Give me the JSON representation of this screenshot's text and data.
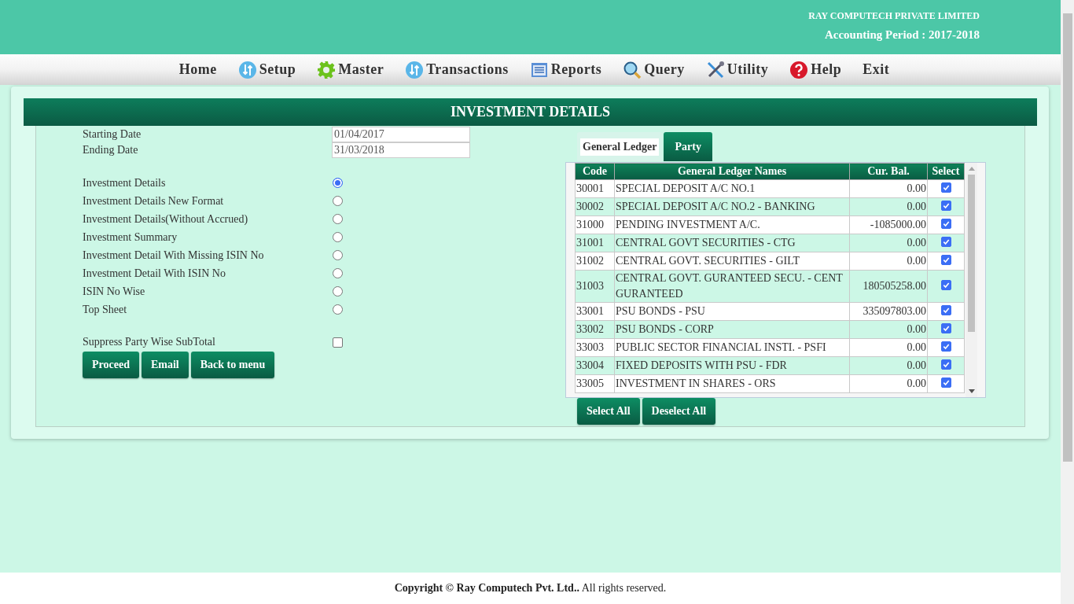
{
  "header": {
    "company": "RAY COMPUTECH PRIVATE LIMITED",
    "period": "Accounting Period : 2017-2018"
  },
  "nav": [
    {
      "label": "Home",
      "kind": "plain"
    },
    {
      "label": "Setup",
      "kind": "arrows"
    },
    {
      "label": "Master",
      "kind": "gear"
    },
    {
      "label": "Transactions",
      "kind": "arrows"
    },
    {
      "label": "Reports",
      "kind": "report"
    },
    {
      "label": "Query",
      "kind": "search"
    },
    {
      "label": "Utility",
      "kind": "tools"
    },
    {
      "label": "Help",
      "kind": "help"
    },
    {
      "label": "Exit",
      "kind": "plain"
    }
  ],
  "title": "INVESTMENT DETAILS",
  "dates": [
    {
      "label": "Starting Date",
      "value": "01/04/2017"
    },
    {
      "label": "Ending Date",
      "value": "31/03/2018"
    }
  ],
  "report_options": [
    {
      "label": "Investment Details",
      "selected": true
    },
    {
      "label": "Investment Details New Format",
      "selected": false
    },
    {
      "label": "Investment Details(Without Accrued)",
      "selected": false
    },
    {
      "label": "Investment Summary",
      "selected": false
    },
    {
      "label": "Investment Detail With Missing ISIN No",
      "selected": false
    },
    {
      "label": "Investment Detail With ISIN No",
      "selected": false
    },
    {
      "label": "ISIN No Wise",
      "selected": false
    },
    {
      "label": "Top Sheet",
      "selected": false
    }
  ],
  "suppress": {
    "label": "Suppress Party Wise SubTotal",
    "checked": false
  },
  "buttons": [
    "Proceed",
    "Email",
    "Back to menu"
  ],
  "tabs": [
    {
      "label": "General Ledger",
      "selected": true
    },
    {
      "label": "Party",
      "selected": false
    }
  ],
  "table": {
    "columns": [
      "Code",
      "General Ledger Names",
      "Cur. Bal.",
      "Select"
    ],
    "rows": [
      {
        "code": "30001",
        "name": "SPECIAL DEPOSIT A/C NO.1",
        "balance": "0.00",
        "checked": true
      },
      {
        "code": "30002",
        "name": "SPECIAL DEPOSIT A/C NO.2 - BANKING",
        "balance": "0.00",
        "checked": true
      },
      {
        "code": "31000",
        "name": "PENDING INVESTMENT A/C.",
        "balance": "-1085000.00",
        "checked": true
      },
      {
        "code": "31001",
        "name": "CENTRAL GOVT SECURITIES - CTG",
        "balance": "0.00",
        "checked": true
      },
      {
        "code": "31002",
        "name": "CENTRAL GOVT. SECURITIES - GILT",
        "balance": "0.00",
        "checked": true
      },
      {
        "code": "31003",
        "name": "CENTRAL GOVT. GURANTEED SECU. - CENT GURANTEED",
        "balance": "180505258.00",
        "checked": true
      },
      {
        "code": "33001",
        "name": "PSU BONDS - PSU",
        "balance": "335097803.00",
        "checked": true
      },
      {
        "code": "33002",
        "name": "PSU BONDS - CORP",
        "balance": "0.00",
        "checked": true
      },
      {
        "code": "33003",
        "name": "PUBLIC SECTOR FINANCIAL INSTI. - PSFI",
        "balance": "0.00",
        "checked": true
      },
      {
        "code": "33004",
        "name": "FIXED DEPOSITS WITH PSU - FDR",
        "balance": "0.00",
        "checked": true
      },
      {
        "code": "33005",
        "name": "INVESTMENT IN SHARES - ORS",
        "balance": "0.00",
        "checked": true
      }
    ]
  },
  "table_buttons": [
    "Select All",
    "Deselect All"
  ],
  "footer": {
    "text": "**Copyright © Ray Computech Pvt. Ltd..** All rights reserved."
  }
}
